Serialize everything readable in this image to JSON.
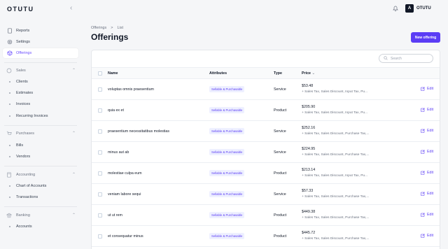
{
  "app": {
    "logo": "OTUTU",
    "user": {
      "initial": "A",
      "name": "OTUTU"
    }
  },
  "sidebar": {
    "top_items": [
      {
        "label": "Reports",
        "icon": "document-icon"
      },
      {
        "label": "Settings",
        "icon": "settings-icon"
      },
      {
        "label": "Offerings",
        "icon": "cube-icon",
        "active": true
      }
    ],
    "groups": [
      {
        "label": "Sales",
        "icon": "dollar-icon",
        "items": [
          "Clients",
          "Estimates",
          "Invoices",
          "Recurring Invoices"
        ]
      },
      {
        "label": "Purchases",
        "icon": "cart-icon",
        "items": [
          "Bills",
          "Vendors"
        ]
      },
      {
        "label": "Accounting",
        "icon": "calculator-icon",
        "items": [
          "Chart of Accounts",
          "Transactions"
        ]
      },
      {
        "label": "Banking",
        "icon": "bank-icon",
        "items": [
          "Accounts"
        ]
      }
    ]
  },
  "breadcrumb": {
    "parent": "Offerings",
    "separator": ">",
    "current": "List"
  },
  "page": {
    "title": "Offerings",
    "new_button": "New offering"
  },
  "search": {
    "placeholder": "Search"
  },
  "table": {
    "headers": {
      "name": "Name",
      "attributes": "Attributes",
      "type": "Type",
      "price": "Price"
    },
    "edit_label": "Edit",
    "rows": [
      {
        "name": "voluptas omnis praesentium",
        "attribute": "Sellable & Purchasable",
        "type": "Service",
        "price": "$53.48",
        "taxes": "+ Sales Tax, Sales Discount, Input Tax, Pu..."
      },
      {
        "name": "quia ex et",
        "attribute": "Sellable & Purchasable",
        "type": "Product",
        "price": "$205.90",
        "taxes": "+ Sales Tax, Sales Discount, Input Tax, Pu..."
      },
      {
        "name": "praesentium necessitatibus molestias",
        "attribute": "Sellable & Purchasable",
        "type": "Service",
        "price": "$252.16",
        "taxes": "+ Sales Tax, Sales Discount, Purchase Tax,..."
      },
      {
        "name": "minus aut ab",
        "attribute": "Sellable & Purchasable",
        "type": "Service",
        "price": "$224.95",
        "taxes": "+ Sales Tax, Sales Discount, Purchase Tax,..."
      },
      {
        "name": "molestiae culpa eum",
        "attribute": "Sellable & Purchasable",
        "type": "Product",
        "price": "$213.14",
        "taxes": "+ Sales Tax, Sales Discount, Input Tax, Pu..."
      },
      {
        "name": "veniam labore sequi",
        "attribute": "Sellable & Purchasable",
        "type": "Service",
        "price": "$57.33",
        "taxes": "+ Sales Tax, Sales Discount, Purchase Tax,..."
      },
      {
        "name": "ut ut rem",
        "attribute": "Sellable & Purchasable",
        "type": "Product",
        "price": "$449.38",
        "taxes": "+ Sales Tax, Sales Discount, Purchase Tax,..."
      },
      {
        "name": "et consequatur minus",
        "attribute": "Sellable & Purchasable",
        "type": "Product",
        "price": "$445.72",
        "taxes": "+ Sales Tax, Sales Discount, Purchase Tax,..."
      }
    ]
  },
  "colors": {
    "accent": "#5b3df5",
    "badge_bg": "#eef0ff",
    "background": "#f5f6f8"
  }
}
